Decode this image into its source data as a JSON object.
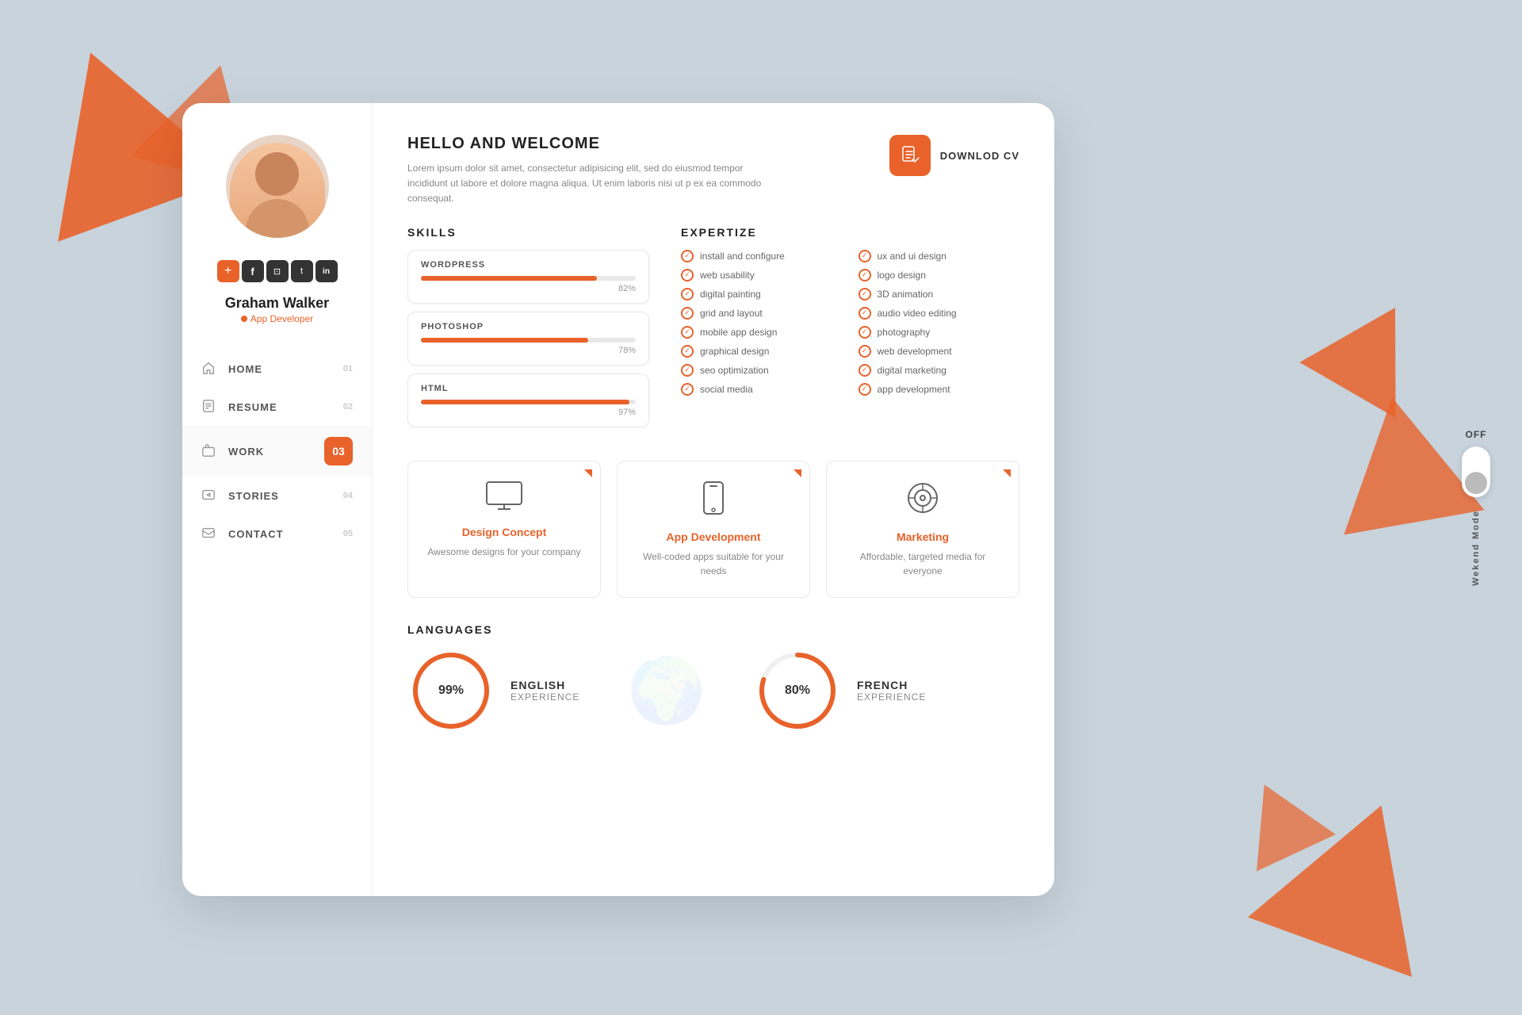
{
  "page": {
    "background": "#c8d3dc"
  },
  "weekend_toggle": {
    "label_off": "OFF",
    "label_mode": "Wekend Mode"
  },
  "profile": {
    "name": "Graham Walker",
    "role": "App Developer",
    "social": {
      "add_label": "+",
      "icons": [
        "f",
        "📷",
        "t",
        "in"
      ]
    }
  },
  "nav": {
    "items": [
      {
        "label": "HOME",
        "number": "01",
        "active": false
      },
      {
        "label": "RESUME",
        "number": "02",
        "active": false
      },
      {
        "label": "WORK",
        "number": "03",
        "active": true
      },
      {
        "label": "STORIES",
        "number": "04",
        "active": false
      },
      {
        "label": "CONTACT",
        "number": "05",
        "active": false
      }
    ]
  },
  "welcome": {
    "title": "HELLO AND WELCOME",
    "text": "Lorem ipsum dolor sit amet, consectetur adipisicing elit, sed do eiusmod tempor incididunt ut labore et dolore magna aliqua. Ut enim laboris nisi ut p ex ea commodo consequat.",
    "download_cv": "DOWNLOD CV"
  },
  "skills": {
    "section_title": "SKILLS",
    "items": [
      {
        "name": "WORDPRESS",
        "percent": 82
      },
      {
        "name": "PHOTOSHOP",
        "percent": 78
      },
      {
        "name": "HTML",
        "percent": 97
      }
    ]
  },
  "expertize": {
    "section_title": "EXPERTIZE",
    "col1": [
      "install and configure",
      "web usability",
      "digital painting",
      "grid and layout",
      "mobile app design",
      "graphical design",
      "seo optimization",
      "social media"
    ],
    "col2": [
      "ux and ui design",
      "logo design",
      "3D animation",
      "audio video editing",
      "photography",
      "web development",
      "digital marketing",
      "app development"
    ]
  },
  "services": {
    "items": [
      {
        "icon": "🖥",
        "title": "Design Concept",
        "desc": "Awesome designs for your company"
      },
      {
        "icon": "📱",
        "title": "App Development",
        "desc": "Well-coded apps suitable for your needs"
      },
      {
        "icon": "🎯",
        "title": "Marketing",
        "desc": "Affordable, targeted media for everyone"
      }
    ]
  },
  "languages": {
    "section_title": "LANGUAGES",
    "items": [
      {
        "name": "ENGLISH",
        "sub": "EXPERIENCE",
        "percent": 99
      },
      {
        "name": "FRENCH",
        "sub": "EXPERIENCE",
        "percent": 80
      }
    ]
  }
}
